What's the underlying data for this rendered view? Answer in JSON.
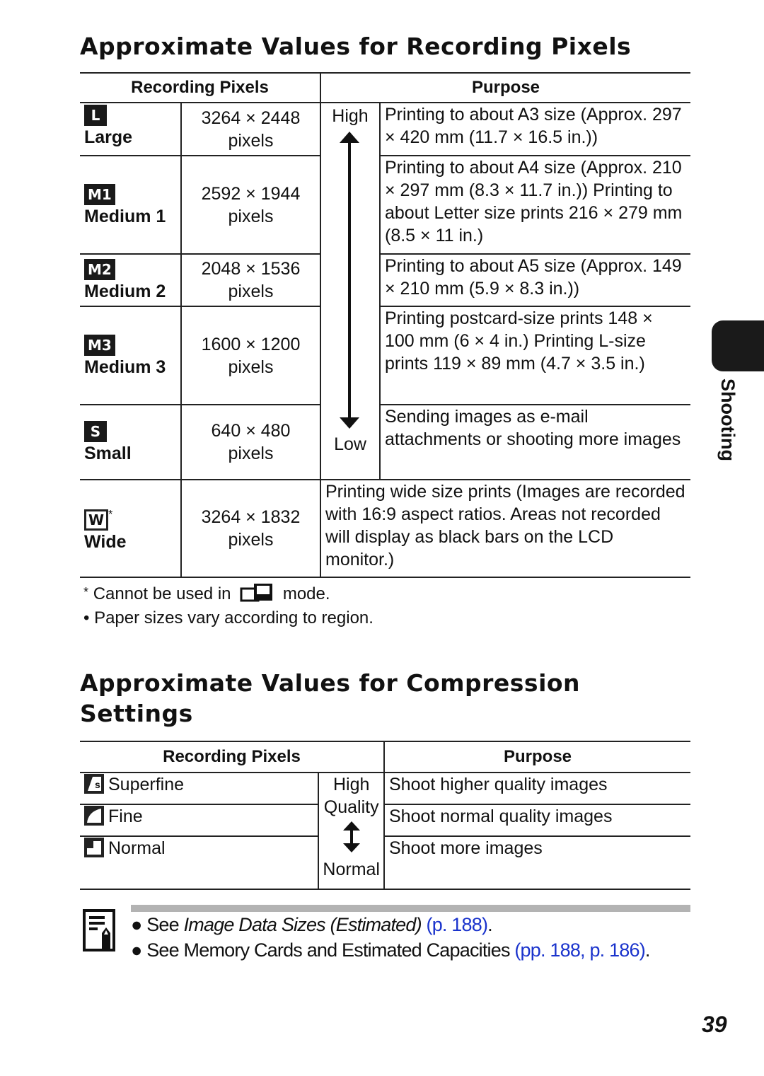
{
  "section1": {
    "title": "Approximate Values for Recording Pixels",
    "headers": [
      "Recording Pixels",
      "Purpose"
    ],
    "scale_high": "High",
    "scale_low": "Low",
    "rows": [
      {
        "icon": "L",
        "name": "Large",
        "size": "3264 × 2448",
        "unit": "pixels",
        "purpose": "Printing to about A3 size (Approx. 297 × 420 mm (11.7 × 16.5 in.))"
      },
      {
        "icon": "M1",
        "name": "Medium 1",
        "size": "2592 × 1944",
        "unit": "pixels",
        "purpose": "Printing to about A4 size (Approx. 210 × 297 mm (8.3 × 11.7 in.)) Printing to about Letter size prints 216 × 279 mm (8.5 × 11 in.)"
      },
      {
        "icon": "M2",
        "name": "Medium 2",
        "size": "2048 × 1536",
        "unit": "pixels",
        "purpose": "Printing to about A5 size (Approx. 149 × 210 mm (5.9 × 8.3 in.))"
      },
      {
        "icon": "M3",
        "name": "Medium 3",
        "size": "1600 × 1200",
        "unit": "pixels",
        "purpose": "Printing postcard-size prints 148 × 100 mm (6 × 4 in.) Printing L-size prints 119 × 89 mm (4.7 × 3.5 in.)"
      },
      {
        "icon": "S",
        "name": "Small",
        "size": "640 × 480",
        "unit": "pixels",
        "purpose": "Sending images as e-mail attachments or shooting more images"
      },
      {
        "icon": "W",
        "asterisk": "*",
        "name": "Wide",
        "size": "3264 × 1832",
        "unit": "pixels",
        "purpose": "Printing wide size prints (Images are recorded with 16:9 aspect ratios. Areas not recorded will display as black bars on the LCD monitor.)"
      }
    ],
    "note_asterisk": "*",
    "note_text_before": "Cannot be used in",
    "note_text_after": "mode.",
    "note_bullet": "•",
    "note_paper": "Paper sizes vary according to region."
  },
  "section2": {
    "title": "Approximate Values for Compression Settings",
    "headers": [
      "Recording Pixels",
      "Purpose"
    ],
    "scale_high": "High",
    "scale_quality": "Quality",
    "scale_normal": "Normal",
    "rows": [
      {
        "name": "Superfine",
        "purpose": "Shoot higher quality images"
      },
      {
        "name": "Fine",
        "purpose": "Shoot normal quality images"
      },
      {
        "name": "Normal",
        "purpose": "Shoot more images"
      }
    ]
  },
  "memo": {
    "line1_prefix": "See ",
    "line1_italic": "Image Data Sizes (Estimated)",
    "line1_link": "(p. 188)",
    "line1_suffix": ".",
    "line2_prefix": "See Memory Cards and Estimated Capacities ",
    "line2_link1": "(pp. 188",
    "line2_sep": ", ",
    "line2_link2": "p. 186)",
    "line2_suffix": ".",
    "link_color": "#1a33cc"
  },
  "side_tab": {
    "label": "Shooting"
  },
  "page_number": "39"
}
